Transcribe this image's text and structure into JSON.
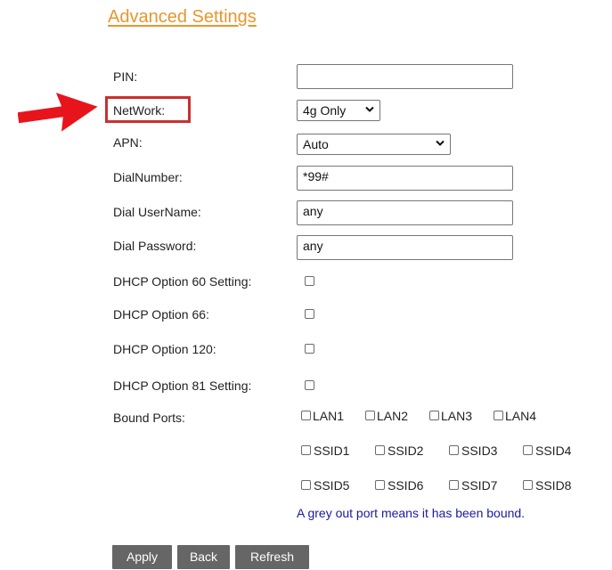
{
  "page": {
    "title": "Advanced Settings",
    "accent_color": "#e8962e",
    "highlight_color": "#c9302c",
    "arrow_icon": "arrow-right-icon"
  },
  "form": {
    "pin": {
      "label": "PIN:",
      "value": ""
    },
    "network": {
      "label": "NetWork:",
      "selected": "4g Only"
    },
    "apn": {
      "label": "APN:",
      "selected": "Auto"
    },
    "dial_number": {
      "label": "DialNumber:",
      "value": "*99#"
    },
    "dial_username": {
      "label": "Dial UserName:",
      "value": "any"
    },
    "dial_password": {
      "label": "Dial Password:",
      "value": "any"
    },
    "dhcp60": {
      "label": "DHCP Option 60 Setting:",
      "checked": false
    },
    "dhcp66": {
      "label": "DHCP Option 66:",
      "checked": false
    },
    "dhcp120": {
      "label": "DHCP Option 120:",
      "checked": false
    },
    "dhcp81": {
      "label": "DHCP Option 81 Setting:",
      "checked": false
    },
    "bound_ports": {
      "label": "Bound Ports:",
      "ports": [
        "LAN1",
        "LAN2",
        "LAN3",
        "LAN4",
        "SSID1",
        "SSID2",
        "SSID3",
        "SSID4",
        "SSID5",
        "SSID6",
        "SSID7",
        "SSID8"
      ],
      "note": "A grey out port means it has been bound.",
      "note_color": "#1a1aa0"
    }
  },
  "buttons": {
    "apply": "Apply",
    "back": "Back",
    "refresh": "Refresh"
  }
}
